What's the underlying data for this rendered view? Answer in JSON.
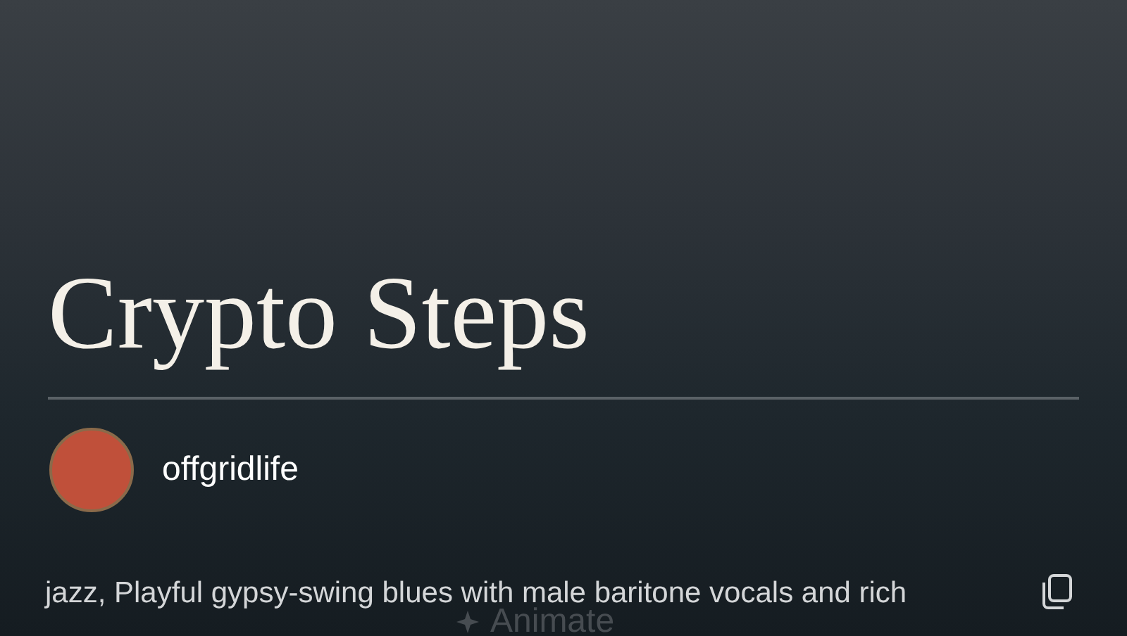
{
  "song": {
    "title": "Crypto Steps"
  },
  "artist": {
    "name": "offgridlife"
  },
  "description": {
    "text": "jazz, Playful gypsy-swing blues with male baritone vocals and rich"
  },
  "overlay_button": {
    "label": "Animate"
  }
}
